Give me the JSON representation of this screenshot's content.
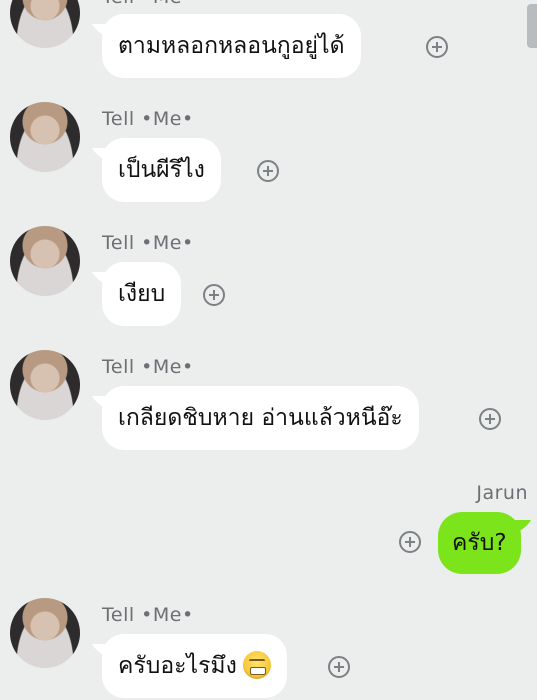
{
  "partial_sender": "Tell •Me•",
  "messages": [
    {
      "sender": "Tell •Me•",
      "text": "ตามหลอกหลอนกูอยู่ได้"
    },
    {
      "sender": "Tell •Me•",
      "text": "เป็นผีรึไง"
    },
    {
      "sender": "Tell •Me•",
      "text": "เงียบ"
    },
    {
      "sender": "Tell •Me•",
      "text": "เกลียดชิบหาย อ่านแล้วหนีอ๊ะ"
    },
    {
      "sender": "Jarun",
      "text": "ครับ?"
    },
    {
      "sender": "Tell •Me•",
      "text": "ครับอะไรมึง",
      "emoji": "grimacing-face"
    }
  ],
  "colors": {
    "background": "#eceded",
    "incoming_bubble": "#ffffff",
    "outgoing_bubble": "#7be41b",
    "sender_text": "#6c6f73"
  },
  "icons": {
    "reaction": "plus-circle-icon",
    "emoji": "grimacing-face-emoji"
  }
}
